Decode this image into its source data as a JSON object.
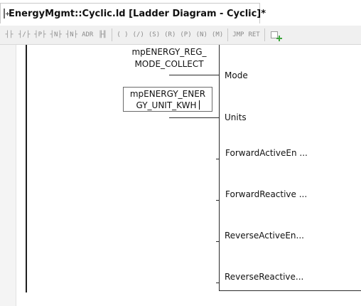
{
  "tab": {
    "title": "EnergyMgmt::Cyclic.ld [Ladder Diagram - Cyclic]*",
    "icon": "ladder-file-icon"
  },
  "toolbar": {
    "groups": [
      [
        {
          "name": "contact-no-icon",
          "glyph": "┤├"
        },
        {
          "name": "contact-nc-icon",
          "glyph": "┤/├"
        },
        {
          "name": "contact-p-icon",
          "glyph": "┤P├"
        },
        {
          "name": "contact-n-icon",
          "glyph": "┤N├"
        },
        {
          "name": "contact-inv-icon",
          "glyph": "┤N├"
        },
        {
          "name": "contact-adr-icon",
          "glyph": "ADR"
        },
        {
          "name": "contact-parallel-icon",
          "glyph": "╟╢"
        }
      ],
      [
        {
          "name": "coil-icon",
          "glyph": "( )"
        },
        {
          "name": "coil-negated-icon",
          "glyph": "(/)"
        },
        {
          "name": "coil-set-icon",
          "glyph": "(S)"
        },
        {
          "name": "coil-reset-icon",
          "glyph": "(R)"
        },
        {
          "name": "coil-p-icon",
          "glyph": "(P)"
        },
        {
          "name": "coil-n-icon",
          "glyph": "(N)"
        },
        {
          "name": "coil-m-icon",
          "glyph": "(M)"
        }
      ],
      [
        {
          "name": "jump-icon",
          "glyph": "JMP"
        },
        {
          "name": "return-icon",
          "glyph": "RET"
        }
      ]
    ],
    "insert_network_icon": "insert-network-icon"
  },
  "block": {
    "input_mode_value": [
      "mpENERGY_REG_",
      "MODE_COLLECT"
    ],
    "input_units_value": [
      "mpENERGY_ENER",
      "GY_UNIT_KWH"
    ],
    "pins": {
      "mode": "Mode",
      "units": "Units",
      "forward_active": "ForwardActiveEn ...",
      "forward_reactive": "ForwardReactive ...",
      "reverse_active": "ReverseActiveEn...",
      "reverse_reactive": "ReverseReactive..."
    }
  }
}
